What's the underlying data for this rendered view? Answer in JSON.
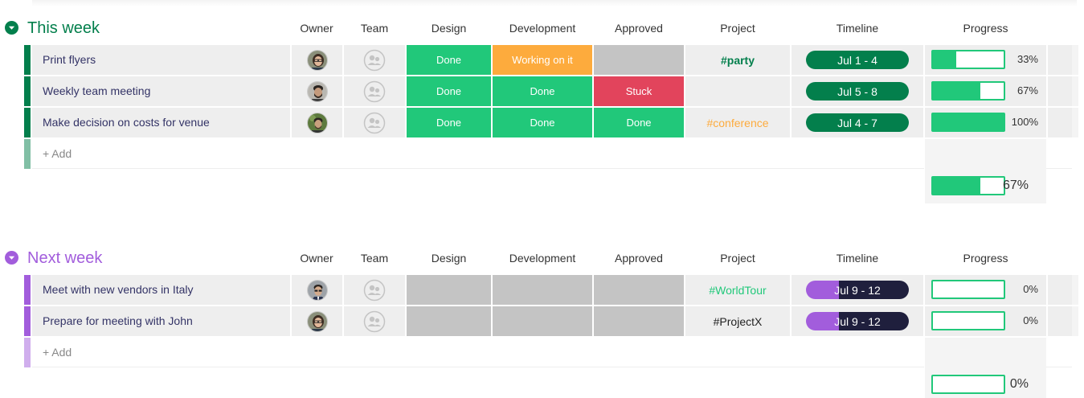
{
  "colors": {
    "done": "#21c87a",
    "working": "#fdab3d",
    "stuck": "#e2445c",
    "empty": "#c4c4c4",
    "green_group": "#037f4c",
    "purple_group": "#a25ddc",
    "timeline_dark": "#1f1f3d"
  },
  "columns": {
    "owner": "Owner",
    "team": "Team",
    "design": "Design",
    "development": "Development",
    "approved": "Approved",
    "project": "Project",
    "timeline": "Timeline",
    "progress": "Progress"
  },
  "groups": [
    {
      "title": "This week",
      "add_label": "+ Add",
      "summary_progress": "67%",
      "summary_fraction": 0.67,
      "items": [
        {
          "name": "Print flyers",
          "avatar": "woman-glasses-avatar",
          "team_icon": "team-placeholder-icon",
          "design": "Done",
          "development": "Working on it",
          "approved": "",
          "project": "#party",
          "timeline": "Jul 1 - 4",
          "progress": "33%",
          "fraction": 0.33
        },
        {
          "name": "Weekly team meeting",
          "avatar": "man-beard-avatar",
          "team_icon": "team-placeholder-icon",
          "design": "Done",
          "development": "Done",
          "approved": "Stuck",
          "project": "",
          "timeline": "Jul 5 - 8",
          "progress": "67%",
          "fraction": 0.67
        },
        {
          "name": "Make decision on costs for venue",
          "avatar": "man-outdoor-avatar",
          "team_icon": "team-placeholder-icon",
          "design": "Done",
          "development": "Done",
          "approved": "Done",
          "project": "#conference",
          "timeline": "Jul 4 - 7",
          "progress": "100%",
          "fraction": 1.0
        }
      ]
    },
    {
      "title": "Next week",
      "add_label": "+ Add",
      "summary_progress": "0%",
      "summary_fraction": 0,
      "items": [
        {
          "name": "Meet with new vendors in Italy",
          "avatar": "man-suit-avatar",
          "team_icon": "team-placeholder-icon",
          "design": "",
          "development": "",
          "approved": "",
          "project": "#WorldTour",
          "timeline": "Jul 9 - 12",
          "progress": "0%",
          "fraction": 0
        },
        {
          "name": "Prepare for meeting with John",
          "avatar": "woman-glasses-avatar",
          "team_icon": "team-placeholder-icon",
          "design": "",
          "development": "",
          "approved": "",
          "project": "#ProjectX",
          "timeline": "Jul 9 - 12",
          "progress": "0%",
          "fraction": 0
        }
      ]
    }
  ]
}
